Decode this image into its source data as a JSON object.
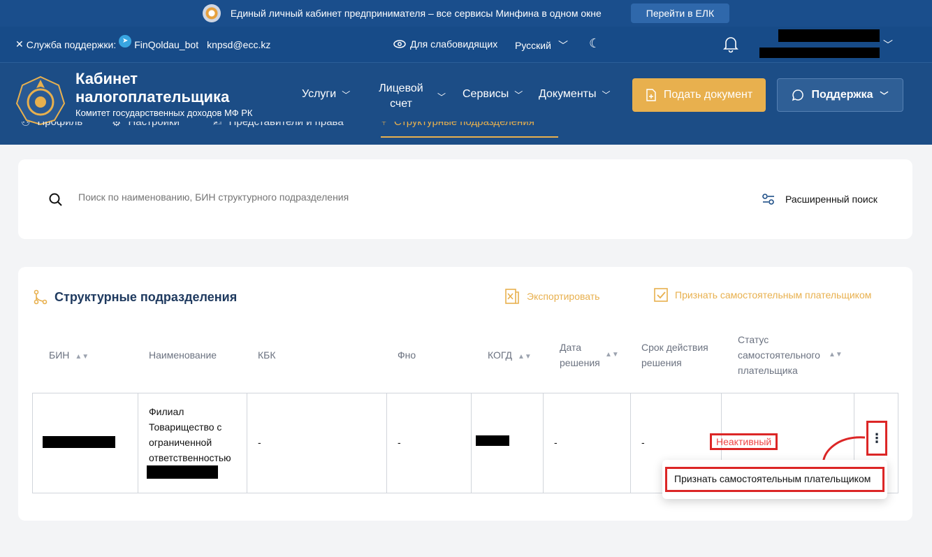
{
  "banner": {
    "text": "Единый личный кабинет предпринимателя – все сервисы Минфина в одном окне",
    "button": "Перейти в ЕЛК"
  },
  "topbar": {
    "support_label": "Служба поддержки:",
    "telegram_bot": "FinQoldau_bot",
    "email": "knpsd@ecc.kz",
    "accessibility": "Для слабовидящих",
    "language": "Русский"
  },
  "header": {
    "title": "Кабинет налогоплательщика",
    "subtitle": "Комитет государственных доходов МФ РК",
    "nav": [
      {
        "label": "Услуги"
      },
      {
        "label": "Лицевой счет"
      },
      {
        "label": "Сервисы"
      },
      {
        "label": "Документы"
      }
    ],
    "submit_button": "Подать документ",
    "support_button": "Поддержка",
    "tabs": [
      {
        "label": "Профиль"
      },
      {
        "label": "Настройки"
      },
      {
        "label": "Представители и права"
      },
      {
        "label": "Структурные подразделения"
      }
    ]
  },
  "search": {
    "placeholder": "Поиск по наименованию, БИН структурного подразделения",
    "advanced_label": "Расширенный поиск"
  },
  "list": {
    "title": "Структурные подразделения",
    "export_label": "Экспортировать",
    "recognize_label": "Признать самостоятельным плательщиком",
    "columns": [
      "БИН",
      "Наименование",
      "КБК",
      "Фно",
      "КОГД",
      "Дата решения",
      "Срок действия решения",
      "Статус самостоятельного плательщика"
    ],
    "row": {
      "name": "Филиал Товарищество с ограниченной ответственностью",
      "kbk": "-",
      "fno": "-",
      "date": "-",
      "term": "-",
      "status": "Неактивный"
    },
    "menu_item": "Признать самостоятельным плательщиком"
  },
  "colors": {
    "header_bg": "#1c4d86",
    "accent": "#e8b04e",
    "highlight": "#dc2626"
  }
}
